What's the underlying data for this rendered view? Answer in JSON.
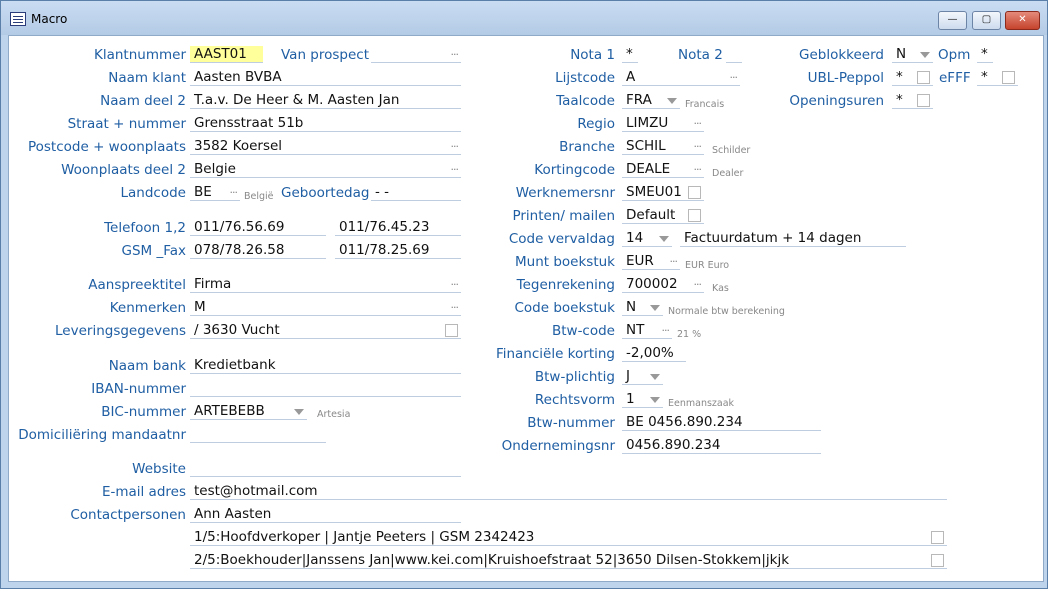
{
  "window": {
    "title": "Macro",
    "icon": "document-list-icon",
    "minimize": "—",
    "maximize": "▢",
    "close": "✕"
  },
  "left": {
    "klantnummer": {
      "label": "Klantnummer",
      "value": "AAST01"
    },
    "van_prospect": {
      "label": "Van prospect",
      "value": ""
    },
    "naam_klant": {
      "label": "Naam klant",
      "value": "Aasten BVBA"
    },
    "naam_deel2": {
      "label": "Naam deel 2",
      "value": "T.a.v. De Heer & M. Aasten Jan"
    },
    "straat": {
      "label": "Straat + nummer",
      "value": "Grensstraat 51b"
    },
    "postcode": {
      "label": "Postcode + woonplaats",
      "value": "3582 Koersel"
    },
    "woonplaats2": {
      "label": "Woonplaats deel 2",
      "value": "Belgie"
    },
    "landcode": {
      "label": "Landcode",
      "value": "BE",
      "hint": "België"
    },
    "geboortedag": {
      "label": "Geboortedag",
      "value": "-  -"
    },
    "telefoon": {
      "label": "Telefoon 1,2",
      "value1": "011/76.56.69",
      "value2": "011/76.45.23"
    },
    "gsm": {
      "label": "GSM _Fax",
      "value1": "078/78.26.58",
      "value2": "011/78.25.69"
    },
    "aanspreektitel": {
      "label": "Aanspreektitel",
      "value": "Firma"
    },
    "kenmerken": {
      "label": "Kenmerken",
      "value": "M"
    },
    "levering": {
      "label": "Leveringsgegevens",
      "value": "/ 3630 Vucht"
    },
    "naam_bank": {
      "label": "Naam bank",
      "value": "Kredietbank"
    },
    "iban": {
      "label": "IBAN-nummer",
      "value": ""
    },
    "bic": {
      "label": "BIC-nummer",
      "value": "ARTEBEBB",
      "hint": "Artesia"
    },
    "domiciliering": {
      "label": "Domiciliëring mandaatnr",
      "value": ""
    },
    "website": {
      "label": "Website",
      "value": ""
    },
    "email": {
      "label": "E-mail adres",
      "value": "test@hotmail.com"
    },
    "contact": {
      "label": "Contactpersonen",
      "value": "Ann Aasten"
    },
    "contacts": [
      "1/5:Hoofdverkoper | Jantje Peeters | GSM 2342423",
      "2/5:Boekhouder|Janssens Jan|www.kei.com|Kruishoefstraat 52|3650 Dilsen-Stokkem|jkjk"
    ]
  },
  "middle": {
    "nota1": {
      "label": "Nota 1",
      "value": "*"
    },
    "nota2": {
      "label": "Nota 2",
      "value": ""
    },
    "lijstcode": {
      "label": "Lijstcode",
      "value": "A"
    },
    "taalcode": {
      "label": "Taalcode",
      "value": "FRA",
      "hint": "Francais"
    },
    "regio": {
      "label": "Regio",
      "value": "LIMZU"
    },
    "branche": {
      "label": "Branche",
      "value": "SCHIL",
      "hint": "Schilder"
    },
    "kortingcode": {
      "label": "Kortingcode",
      "value": "DEALE",
      "hint": "Dealer"
    },
    "werknemersnr": {
      "label": "Werknemersnr",
      "value": "SMEU01"
    },
    "printen": {
      "label": "Printen/ mailen",
      "value": "Default"
    },
    "vervaldag": {
      "label": "Code vervaldag",
      "value": "14",
      "desc": "Factuurdatum + 14 dagen"
    },
    "munt": {
      "label": "Munt boekstuk",
      "value": "EUR",
      "hint": "EUR Euro"
    },
    "tegenrekening": {
      "label": "Tegenrekening",
      "value": "700002",
      "hint": "Kas"
    },
    "code_boekstuk": {
      "label": "Code boekstuk",
      "value": "N",
      "hint": "Normale btw berekening"
    },
    "btw_code": {
      "label": "Btw-code",
      "value": "NT",
      "hint": "21 %"
    },
    "fin_korting": {
      "label": "Financiële korting",
      "value": "-2,00%"
    },
    "btw_plichtig": {
      "label": "Btw-plichtig",
      "value": "J"
    },
    "rechtsvorm": {
      "label": "Rechtsvorm",
      "value": "1",
      "hint": "Eenmanszaak"
    },
    "btw_nummer": {
      "label": "Btw-nummer",
      "value": "BE 0456.890.234"
    },
    "ondernemingsnr": {
      "label": "Ondernemingsnr",
      "value": "0456.890.234"
    }
  },
  "right": {
    "geblokkeerd": {
      "label": "Geblokkeerd",
      "value": "N"
    },
    "opm": {
      "label": "Opm",
      "value": "*"
    },
    "ubl": {
      "label": "UBL-Peppol",
      "value": "*"
    },
    "efff": {
      "label": "eFFF",
      "value": "*"
    },
    "openingsuren": {
      "label": "Openingsuren",
      "value": "*"
    }
  },
  "colors": {
    "label": "#1f5ea3",
    "highlight": "#ffff9c",
    "titlebar": "#bed3ec"
  }
}
